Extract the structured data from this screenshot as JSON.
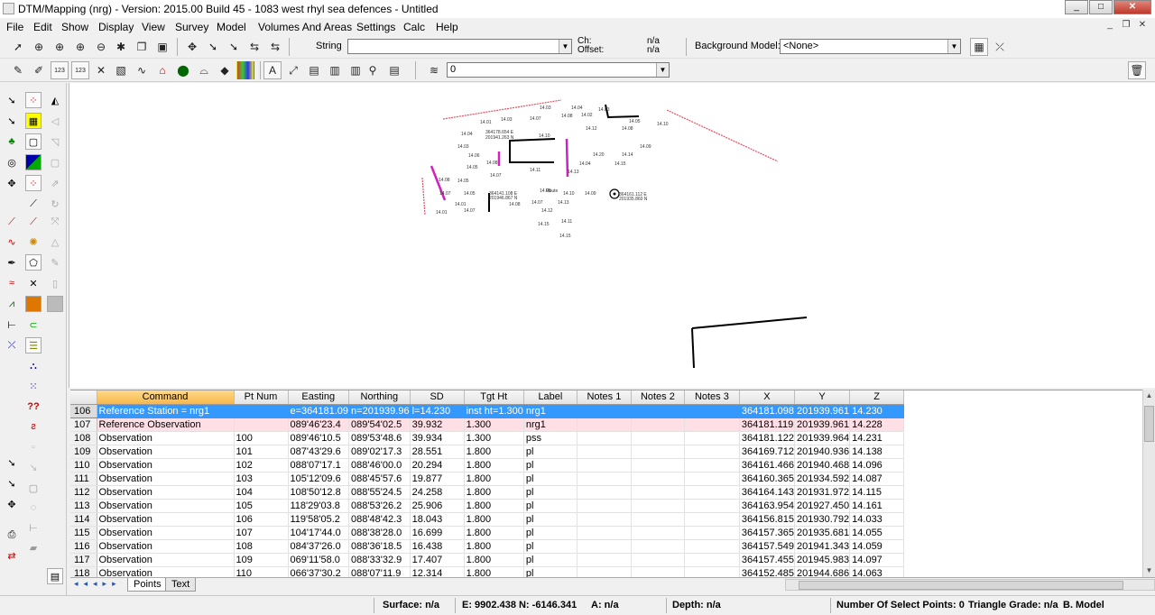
{
  "window": {
    "title": "DTM/Mapping (nrg) - Version: 2015.00 Build 45 - 1083 west rhyl sea defences - Untitled",
    "min_label": "_",
    "max_label": "□",
    "close_label": "✕",
    "mdi_min": "_",
    "mdi_restore": "❐",
    "mdi_close": "✕"
  },
  "menu": {
    "items": [
      "File",
      "Edit",
      "Show",
      "Display",
      "View",
      "Survey",
      "Model",
      "Volumes And Areas",
      "Settings",
      "Calc",
      "Help"
    ]
  },
  "toolbar": {
    "string_label": "String",
    "string_value": "",
    "ch_label": "Ch:",
    "offset_label": "Offset:",
    "ch_value": "n/a",
    "offset_value": "n/a",
    "background_model_label": "Background Model:",
    "background_model_value": "<None>",
    "layer_value": "0"
  },
  "grid": {
    "columns": [
      "Command",
      "Pt Num",
      "Easting",
      "Northing",
      "SD",
      "Tgt Ht",
      "Label",
      "Notes 1",
      "Notes 2",
      "Notes 3",
      "X",
      "Y",
      "Z"
    ],
    "rows": [
      {
        "num": "106",
        "cells": [
          "Reference Station = nrg1",
          "",
          "e=364181.09",
          "n=201939.96",
          "l=14.230",
          "inst ht=1.300",
          "nrg1",
          "",
          "",
          "",
          "364181.098",
          "201939.961",
          "14.230"
        ],
        "state": "selected"
      },
      {
        "num": "107",
        "cells": [
          "Reference Observation",
          "",
          "089'46'23.4",
          "089'54'02.5",
          "39.932",
          "1.300",
          "nrg1",
          "",
          "",
          "",
          "364181.119",
          "201939.961",
          "14.228"
        ],
        "state": "highlight"
      },
      {
        "num": "108",
        "cells": [
          "Observation",
          "100",
          "089'46'10.5",
          "089'53'48.6",
          "39.934",
          "1.300",
          "pss",
          "",
          "",
          "",
          "364181.122",
          "201939.964",
          "14.231"
        ],
        "state": "normal"
      },
      {
        "num": "109",
        "cells": [
          "Observation",
          "101",
          "087'43'29.6",
          "089'02'17.3",
          "28.551",
          "1.800",
          "pl",
          "",
          "",
          "",
          "364169.712",
          "201940.936",
          "14.138"
        ],
        "state": "normal"
      },
      {
        "num": "110",
        "cells": [
          "Observation",
          "102",
          "088'07'17.1",
          "088'46'00.0",
          "20.294",
          "1.800",
          "pl",
          "",
          "",
          "",
          "364161.466",
          "201940.468",
          "14.096"
        ],
        "state": "normal"
      },
      {
        "num": "111",
        "cells": [
          "Observation",
          "103",
          "105'12'09.6",
          "088'45'57.6",
          "19.877",
          "1.800",
          "pl",
          "",
          "",
          "",
          "364160.365",
          "201934.592",
          "14.087"
        ],
        "state": "normal"
      },
      {
        "num": "112",
        "cells": [
          "Observation",
          "104",
          "108'50'12.8",
          "088'55'24.5",
          "24.258",
          "1.800",
          "pl",
          "",
          "",
          "",
          "364164.143",
          "201931.972",
          "14.115"
        ],
        "state": "normal"
      },
      {
        "num": "113",
        "cells": [
          "Observation",
          "105",
          "118'29'03.8",
          "088'53'26.2",
          "25.906",
          "1.800",
          "pl",
          "",
          "",
          "",
          "364163.954",
          "201927.450",
          "14.161"
        ],
        "state": "normal"
      },
      {
        "num": "114",
        "cells": [
          "Observation",
          "106",
          "119'58'05.2",
          "088'48'42.3",
          "18.043",
          "1.800",
          "pl",
          "",
          "",
          "",
          "364156.815",
          "201930.792",
          "14.033"
        ],
        "state": "normal"
      },
      {
        "num": "115",
        "cells": [
          "Observation",
          "107",
          "104'17'44.0",
          "088'38'28.0",
          "16.699",
          "1.800",
          "pl",
          "",
          "",
          "",
          "364157.365",
          "201935.681",
          "14.055"
        ],
        "state": "normal"
      },
      {
        "num": "116",
        "cells": [
          "Observation",
          "108",
          "084'37'26.0",
          "088'36'18.5",
          "16.438",
          "1.800",
          "pl",
          "",
          "",
          "",
          "364157.549",
          "201941.343",
          "14.059"
        ],
        "state": "normal"
      },
      {
        "num": "117",
        "cells": [
          "Observation",
          "109",
          "069'11'58.0",
          "088'33'32.9",
          "17.407",
          "1.800",
          "pl",
          "",
          "",
          "",
          "364157.455",
          "201945.983",
          "14.097"
        ],
        "state": "normal"
      },
      {
        "num": "118",
        "cells": [
          "Observation",
          "110",
          "066'37'30.2",
          "088'07'11.9",
          "12.314",
          "1.800",
          "pl",
          "",
          "",
          "",
          "364152.485",
          "201944.686",
          "14.063"
        ],
        "state": "normal"
      }
    ]
  },
  "sheet_tabs": [
    "Points",
    "Text"
  ],
  "status": {
    "surface": "Surface: n/a",
    "coords": "E: 9902.438  N: -6146.341",
    "a": "A: n/a",
    "depth": "Depth: n/a",
    "select_points": "Number Of Select Points: 0",
    "triangle_grade": "Triangle Grade: n/a",
    "b_model": "B. Model"
  },
  "colors": {
    "selected_row": "#3399ff",
    "highlight_row": "#ffdfe6",
    "command_header": "#f7b74a",
    "canvas_red": "#e05060",
    "canvas_magenta": "#d020c0"
  }
}
